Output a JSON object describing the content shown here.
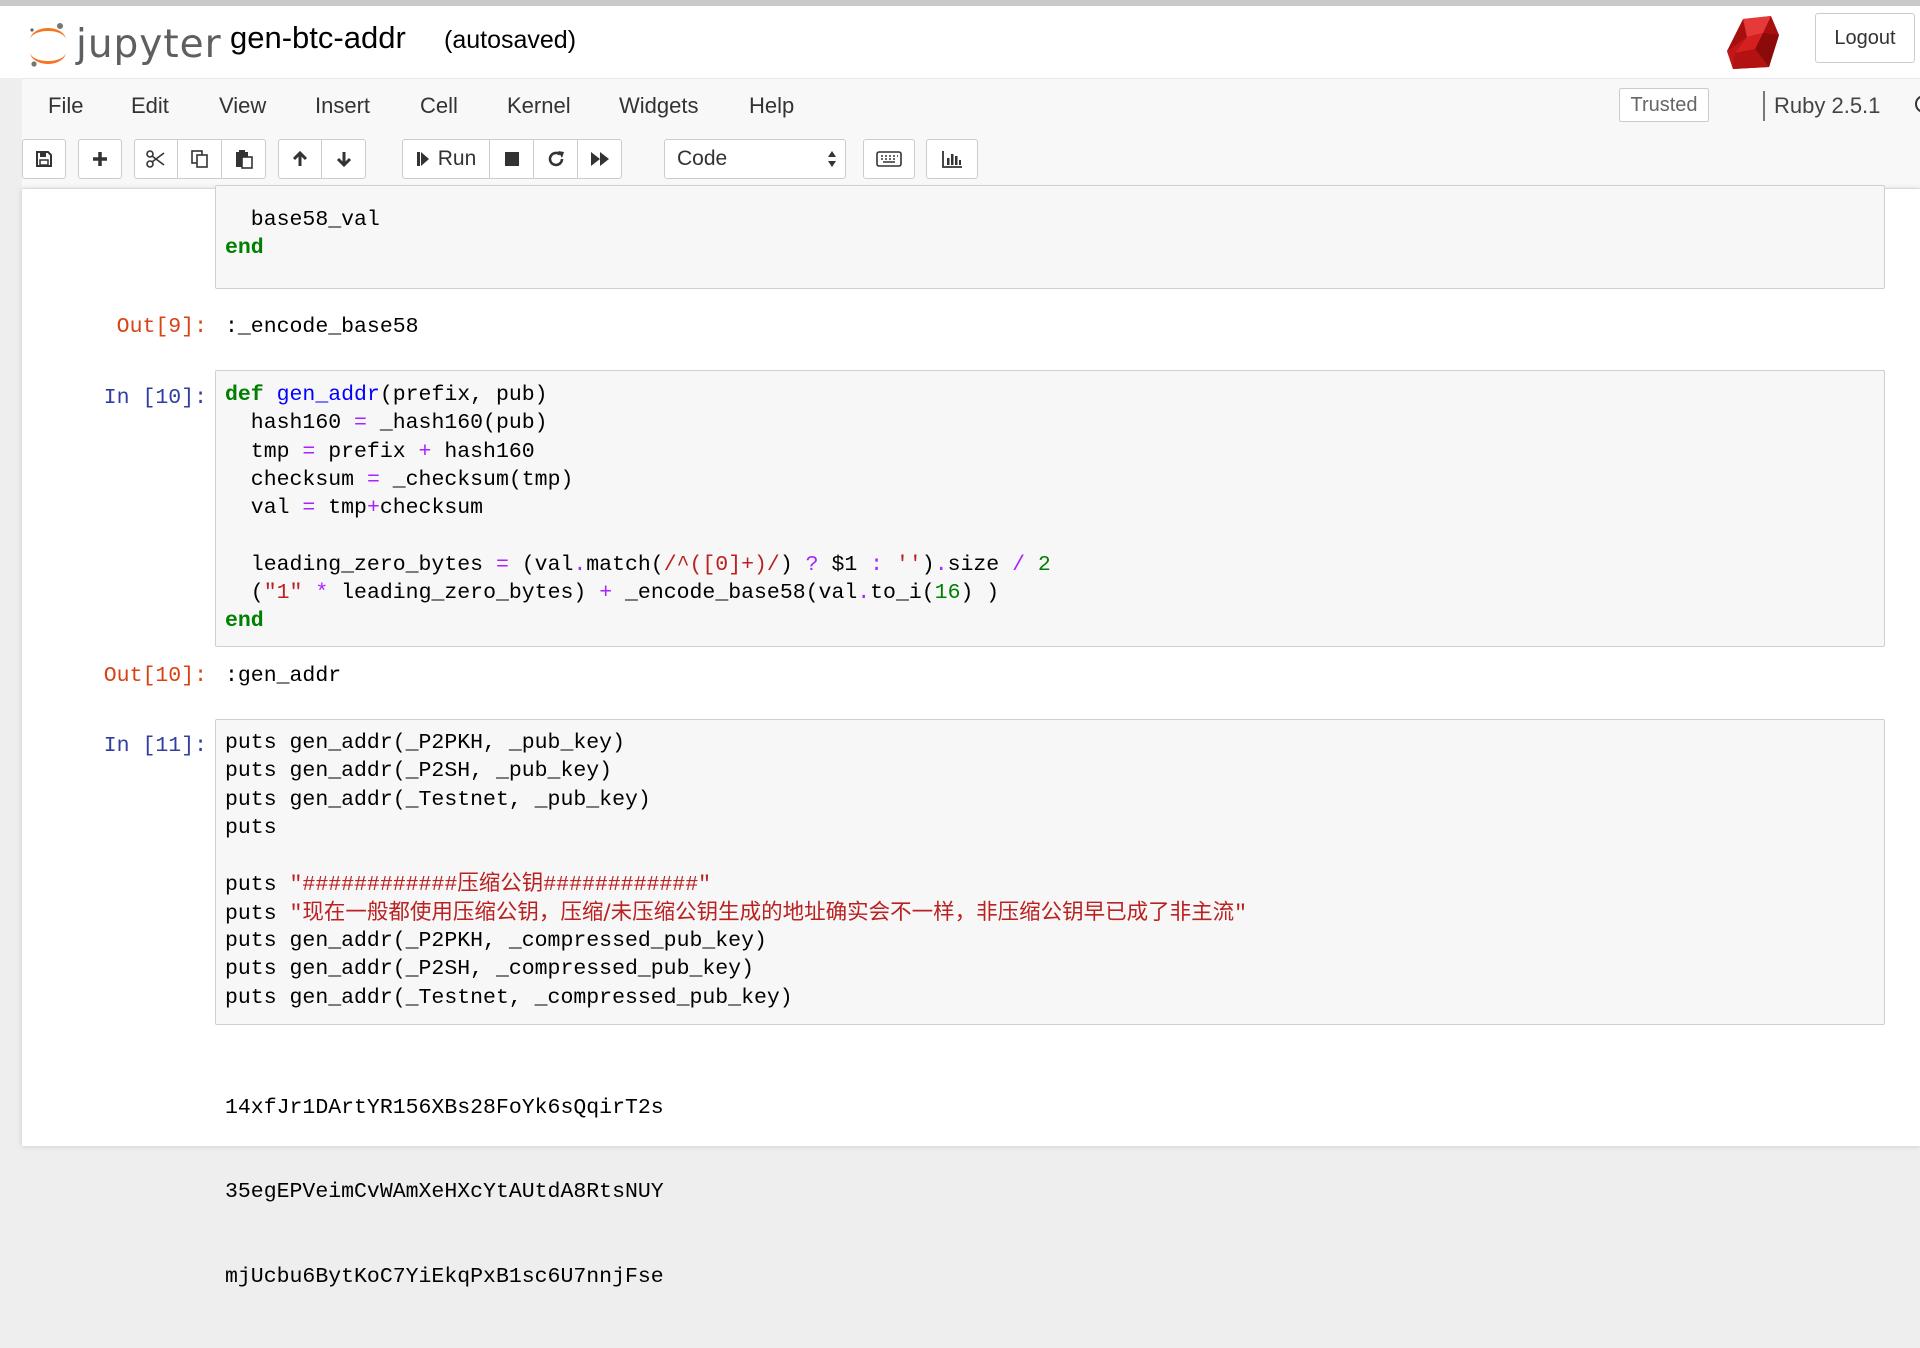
{
  "header": {
    "logo_text": "jupyter",
    "notebook_title": "gen-btc-addr",
    "save_status": "(autosaved)",
    "logout_label": "Logout"
  },
  "menu": {
    "items": [
      "File",
      "Edit",
      "View",
      "Insert",
      "Cell",
      "Kernel",
      "Widgets",
      "Help"
    ],
    "trusted_label": "Trusted",
    "kernel_name": "Ruby 2.5.1"
  },
  "toolbar": {
    "run_label": "Run",
    "cell_type": "Code"
  },
  "cells": {
    "c9": {
      "code_tail": [
        "  base58_val",
        "end"
      ],
      "out_prompt": "Out[9]:",
      "output": ":_encode_base58"
    },
    "c10": {
      "in_prompt": "In [10]:",
      "out_prompt": "Out[10]:",
      "output": ":gen_addr"
    },
    "c11": {
      "in_prompt": "In [11]:",
      "output_lines": [
        "14xfJr1DArtYR156XBs28FoYk6sQqirT2s",
        "35egEPVeimCvWAmXeHXcYtAUtdA8RtsNUY",
        "mjUcbu6BytKoC7YiEkqPxB1sc6U7nnjFse"
      ]
    }
  },
  "colors": {
    "keyword": "#008000",
    "function": "#0000ff",
    "operator": "#aa22ff",
    "string": "#ba2121",
    "in_prompt": "#303f9f",
    "out_prompt": "#d84315",
    "jupyter_orange": "#f37726"
  },
  "icons": [
    "save-icon",
    "plus-icon",
    "scissors-icon",
    "copy-icon",
    "paste-icon",
    "arrow-up-icon",
    "arrow-down-icon",
    "step-forward-icon",
    "stop-icon",
    "restart-icon",
    "fast-forward-icon",
    "keyboard-icon",
    "chart-icon",
    "ruby-logo-icon",
    "jupyter-logo-icon"
  ]
}
